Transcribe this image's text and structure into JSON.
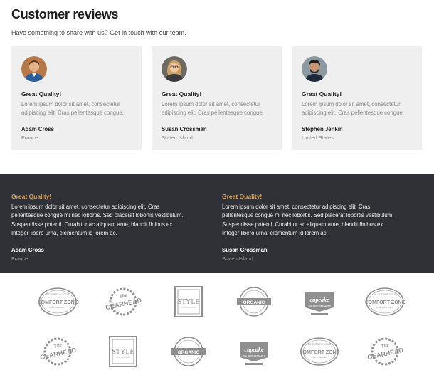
{
  "header": {
    "title": "Customer reviews",
    "subtitle": "Have something to share with us? Get in touch with our team."
  },
  "cards": [
    {
      "heading": "Great Quality!",
      "text": "Lorem ipsum dolor sit amet, consectetur adipiscing elit. Cras pellentesque congue.",
      "author": "Adam Cross",
      "location": "France",
      "avatar_icon": "man-portrait"
    },
    {
      "heading": "Great Quality!",
      "text": "Lorem ipsum dolor sit amet, consectetur adipiscing elit. Cras pellentesque congue.",
      "author": "Susan Crossman",
      "location": "Staten Island",
      "avatar_icon": "woman-portrait"
    },
    {
      "heading": "Great Quality!",
      "text": "Lorem ipsum dolor sit amet, consectetur adipiscing elit. Cras pellentesque congue.",
      "author": "Stephen Jenkin",
      "location": "United States",
      "avatar_icon": "man-portrait"
    }
  ],
  "dark_quotes": [
    {
      "heading": "Great Quality!",
      "text": "Lorem ipsum dolor sit amet, consectetur adipiscing elit. Cras pellentesque congue mi nec lobortis. Sed placerat lobortis vestibulum. Suspendisse potenti. Curabitur ac aliquam ante, blandit finibus ex. Integer libero urna, elementum id lorem ac.",
      "author": "Adam Cross",
      "location": "France"
    },
    {
      "heading": "Great Quality!",
      "text": "Lorem ipsum dolor sit amet, consectetur adipiscing elit. Cras pellentesque congue mi nec lobortis. Sed placerat lobortis vestibulum. Suspendisse potenti. Curabitur ac aliquam ante, blandit finibus ex. Integer libero urna, elementum id lorem ac.",
      "author": "Susan Crossman",
      "location": "Staten Island"
    }
  ],
  "logos": {
    "row1": [
      {
        "name": "comfort-zone-logo",
        "text": "COMFORT ZONE"
      },
      {
        "name": "gearhead-logo",
        "text": "GEARHEAD"
      },
      {
        "name": "style-logo",
        "text": "STYLE"
      },
      {
        "name": "organic-logo",
        "text": "ORGANIC"
      },
      {
        "name": "cupcake-logo",
        "text": "cupcake"
      },
      {
        "name": "comfort-zone-logo",
        "text": "COMFORT ZONE"
      }
    ],
    "row2": [
      {
        "name": "gearhead-logo",
        "text": "GEARHEAD"
      },
      {
        "name": "style-logo",
        "text": "STYLE"
      },
      {
        "name": "organic-logo",
        "text": "ORGANIC"
      },
      {
        "name": "cupcake-logo",
        "text": "cupcake"
      },
      {
        "name": "comfort-zone-logo",
        "text": "COMFORT ZONE"
      },
      {
        "name": "gearhead-logo",
        "text": "GEARHEAD"
      }
    ]
  },
  "colors": {
    "accent": "#d3a25b",
    "dark_bg": "#2f3136",
    "card_bg": "#efefef",
    "logo_gray": "#8f8f8f"
  }
}
